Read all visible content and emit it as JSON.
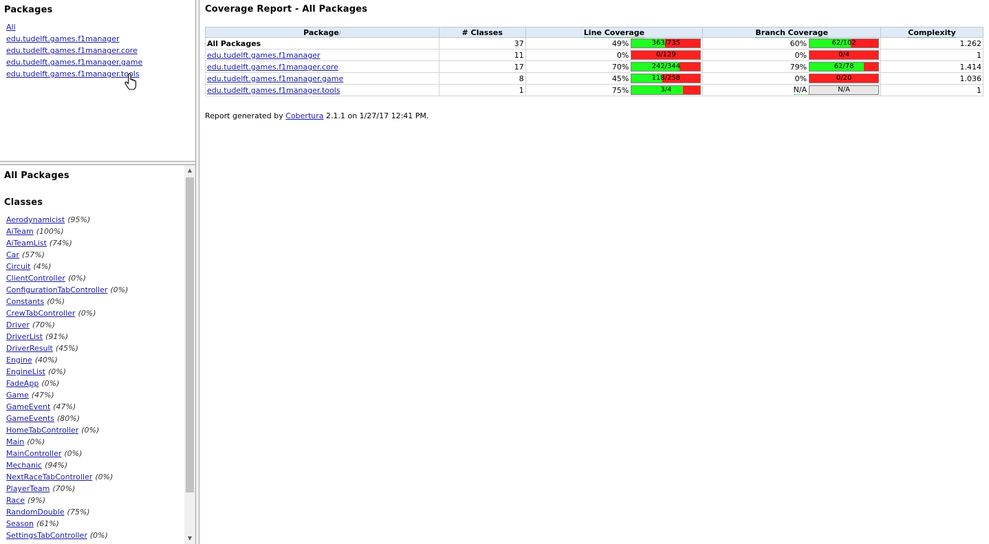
{
  "packages_frame": {
    "title": "Packages",
    "items": [
      "All",
      "edu.tudelft.games.f1manager",
      "edu.tudelft.games.f1manager.core",
      "edu.tudelft.games.f1manager.game",
      "edu.tudelft.games.f1manager.tools"
    ]
  },
  "classes_frame": {
    "title": "All Packages",
    "subtitle": "Classes",
    "items": [
      {
        "name": "Aerodynamicist",
        "pct": "(95%)"
      },
      {
        "name": "AiTeam",
        "pct": "(100%)"
      },
      {
        "name": "AiTeamList",
        "pct": "(74%)"
      },
      {
        "name": "Car",
        "pct": "(57%)"
      },
      {
        "name": "Circuit",
        "pct": "(4%)"
      },
      {
        "name": "ClientController",
        "pct": "(0%)"
      },
      {
        "name": "ConfigurationTabController",
        "pct": "(0%)"
      },
      {
        "name": "Constants",
        "pct": "(0%)"
      },
      {
        "name": "CrewTabController",
        "pct": "(0%)"
      },
      {
        "name": "Driver",
        "pct": "(70%)"
      },
      {
        "name": "DriverList",
        "pct": "(91%)"
      },
      {
        "name": "DriverResult",
        "pct": "(45%)"
      },
      {
        "name": "Engine",
        "pct": "(40%)"
      },
      {
        "name": "EngineList",
        "pct": "(0%)"
      },
      {
        "name": "FadeApp",
        "pct": "(0%)"
      },
      {
        "name": "Game",
        "pct": "(47%)"
      },
      {
        "name": "GameEvent",
        "pct": "(47%)"
      },
      {
        "name": "GameEvents",
        "pct": "(80%)"
      },
      {
        "name": "HomeTabController",
        "pct": "(0%)"
      },
      {
        "name": "Main",
        "pct": "(0%)"
      },
      {
        "name": "MainController",
        "pct": "(0%)"
      },
      {
        "name": "Mechanic",
        "pct": "(94%)"
      },
      {
        "name": "NextRaceTabController",
        "pct": "(0%)"
      },
      {
        "name": "PlayerTeam",
        "pct": "(70%)"
      },
      {
        "name": "Race",
        "pct": "(9%)"
      },
      {
        "name": "RandomDouble",
        "pct": "(75%)"
      },
      {
        "name": "Season",
        "pct": "(61%)"
      },
      {
        "name": "SettingsTabController",
        "pct": "(0%)"
      }
    ]
  },
  "report": {
    "title": "Coverage Report - All Packages",
    "headers": {
      "package": "Package",
      "sort_mark": "/",
      "classes": "# Classes",
      "line": "Line Coverage",
      "branch": "Branch Coverage",
      "complexity": "Complexity"
    },
    "rows": [
      {
        "name": "All Packages",
        "link": false,
        "classes": "37",
        "line_pct": "49%",
        "line_frac": 0.49,
        "line_label": "363/735",
        "branch_pct": "60%",
        "branch_frac": 0.6,
        "branch_label": "62/102",
        "complexity": "1.262"
      },
      {
        "name": "edu.tudelft.games.f1manager",
        "link": true,
        "classes": "11",
        "line_pct": "0%",
        "line_frac": 0.0,
        "line_label": "0/129",
        "branch_pct": "0%",
        "branch_frac": 0.0,
        "branch_label": "0/4",
        "complexity": "1"
      },
      {
        "name": "edu.tudelft.games.f1manager.core",
        "link": true,
        "classes": "17",
        "line_pct": "70%",
        "line_frac": 0.7,
        "line_label": "242/344",
        "branch_pct": "79%",
        "branch_frac": 0.79,
        "branch_label": "62/78",
        "complexity": "1.414"
      },
      {
        "name": "edu.tudelft.games.f1manager.game",
        "link": true,
        "classes": "8",
        "line_pct": "45%",
        "line_frac": 0.45,
        "line_label": "118/258",
        "branch_pct": "0%",
        "branch_frac": 0.0,
        "branch_label": "0/20",
        "complexity": "1.036"
      },
      {
        "name": "edu.tudelft.games.f1manager.tools",
        "link": true,
        "classes": "1",
        "line_pct": "75%",
        "line_frac": 0.75,
        "line_label": "3/4",
        "branch_pct": "N/A",
        "branch_frac": null,
        "branch_label": "N/A",
        "complexity": "1"
      }
    ],
    "footer": {
      "prefix": "Report generated by ",
      "tool": "Cobertura",
      "suffix": " 2.1.1 on 1/27/17 12:41 PM."
    }
  },
  "colors": {
    "covered": "#20ff20",
    "uncovered": "#ff2020",
    "header_bg": "#dfeaf5",
    "link": "#1a1aa6"
  }
}
